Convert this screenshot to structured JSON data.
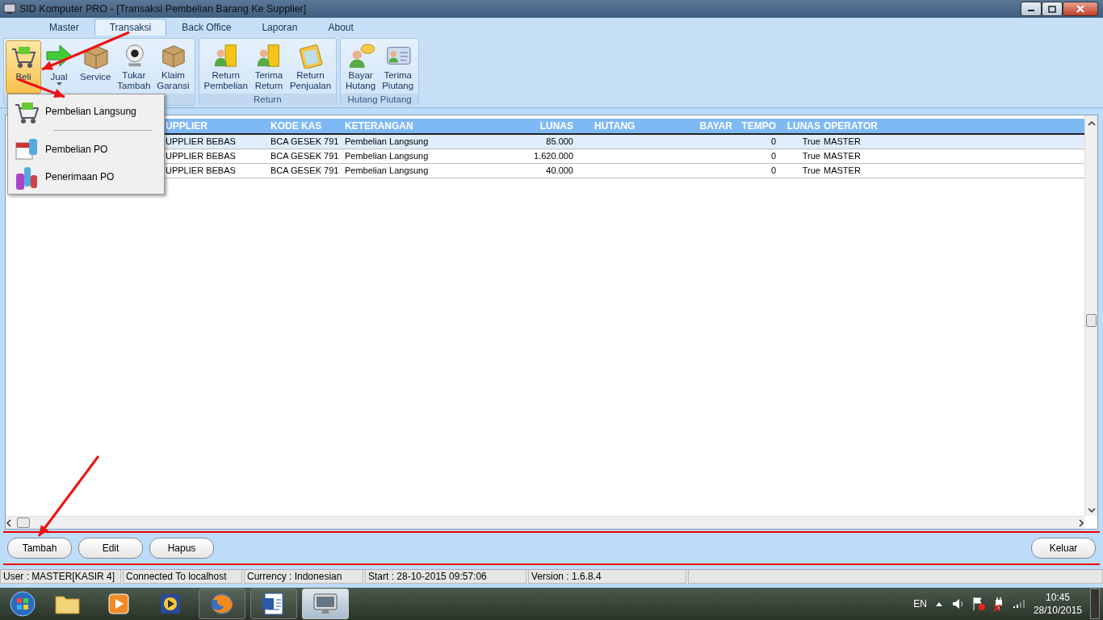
{
  "window": {
    "title": "SID Komputer PRO - [Transaksi Pembelian Barang Ke Supplier]"
  },
  "menu_tabs": [
    {
      "label": "Master",
      "selected": false
    },
    {
      "label": "Transaksi",
      "selected": true
    },
    {
      "label": "Back Office",
      "selected": false
    },
    {
      "label": "Laporan",
      "selected": false
    },
    {
      "label": "About",
      "selected": false
    }
  ],
  "ribbon_groups": [
    {
      "buttons": [
        {
          "label": "Beli",
          "selected": true,
          "dropdown": false
        },
        {
          "label": "Jual",
          "selected": false,
          "dropdown": true
        },
        {
          "label": "Service",
          "selected": false,
          "dropdown": false
        },
        {
          "label": "Tukar Tambah",
          "selected": false,
          "dropdown": false
        },
        {
          "label": "Klaim Garansi",
          "selected": false,
          "dropdown": false
        }
      ]
    },
    {
      "label": "Return",
      "buttons": [
        {
          "label": "Return Pembelian",
          "selected": false,
          "dropdown": false
        },
        {
          "label": "Terima Return",
          "selected": false,
          "dropdown": false
        },
        {
          "label": "Return Penjualan",
          "selected": false,
          "dropdown": false
        }
      ]
    },
    {
      "label": "Hutang Piutang",
      "buttons": [
        {
          "label": "Bayar Hutang",
          "selected": false,
          "dropdown": false
        },
        {
          "label": "Terima Piutang",
          "selected": false,
          "dropdown": false
        }
      ]
    }
  ],
  "dropdown_menu": [
    {
      "kind": "item",
      "label": "Pembelian Langsung"
    },
    {
      "kind": "separator"
    },
    {
      "kind": "item",
      "label": "Pembelian PO"
    },
    {
      "kind": "item",
      "label": "Penerimaan PO"
    }
  ],
  "table": {
    "columns": [
      "UPPLIER",
      "KODE KAS",
      "KETERANGAN",
      "LUNAS",
      "HUTANG",
      "BAYAR",
      "TEMPO",
      "LUNAS",
      "OPERATOR"
    ],
    "rows": [
      {
        "selected": true,
        "cells": [
          "UPPLIER BEBAS",
          "BCA GESEK 791",
          "Pembelian Langsung",
          "85.000",
          "",
          "",
          "0",
          "True",
          "MASTER"
        ]
      },
      {
        "selected": false,
        "cells": [
          "UPPLIER BEBAS",
          "BCA GESEK 791",
          "Pembelian Langsung",
          "1.620.000",
          "",
          "",
          "0",
          "True",
          "MASTER"
        ]
      },
      {
        "selected": false,
        "cells": [
          "UPPLIER BEBAS",
          "BCA GESEK 791",
          "Pembelian Langsung",
          "40.000",
          "",
          "",
          "0",
          "True",
          "MASTER"
        ]
      }
    ]
  },
  "buttons_left": [
    "Tambah",
    "Edit",
    "Hapus"
  ],
  "buttons_right": [
    "Keluar"
  ],
  "status_bar": [
    "User : MASTER[KASIR 4]",
    "Connected To localhost",
    "Currency : Indonesian",
    "Start  : 28-10-2015 09:57:06",
    "Version : 1.6.8.4"
  ],
  "taskbar": {
    "apps": [
      {
        "selected": false
      },
      {
        "selected": false
      },
      {
        "selected": false
      },
      {
        "selected": false
      },
      {
        "selected": false
      },
      {
        "selected": true
      }
    ],
    "language": "EN",
    "time": "10:45",
    "date": "28/10/2015"
  }
}
